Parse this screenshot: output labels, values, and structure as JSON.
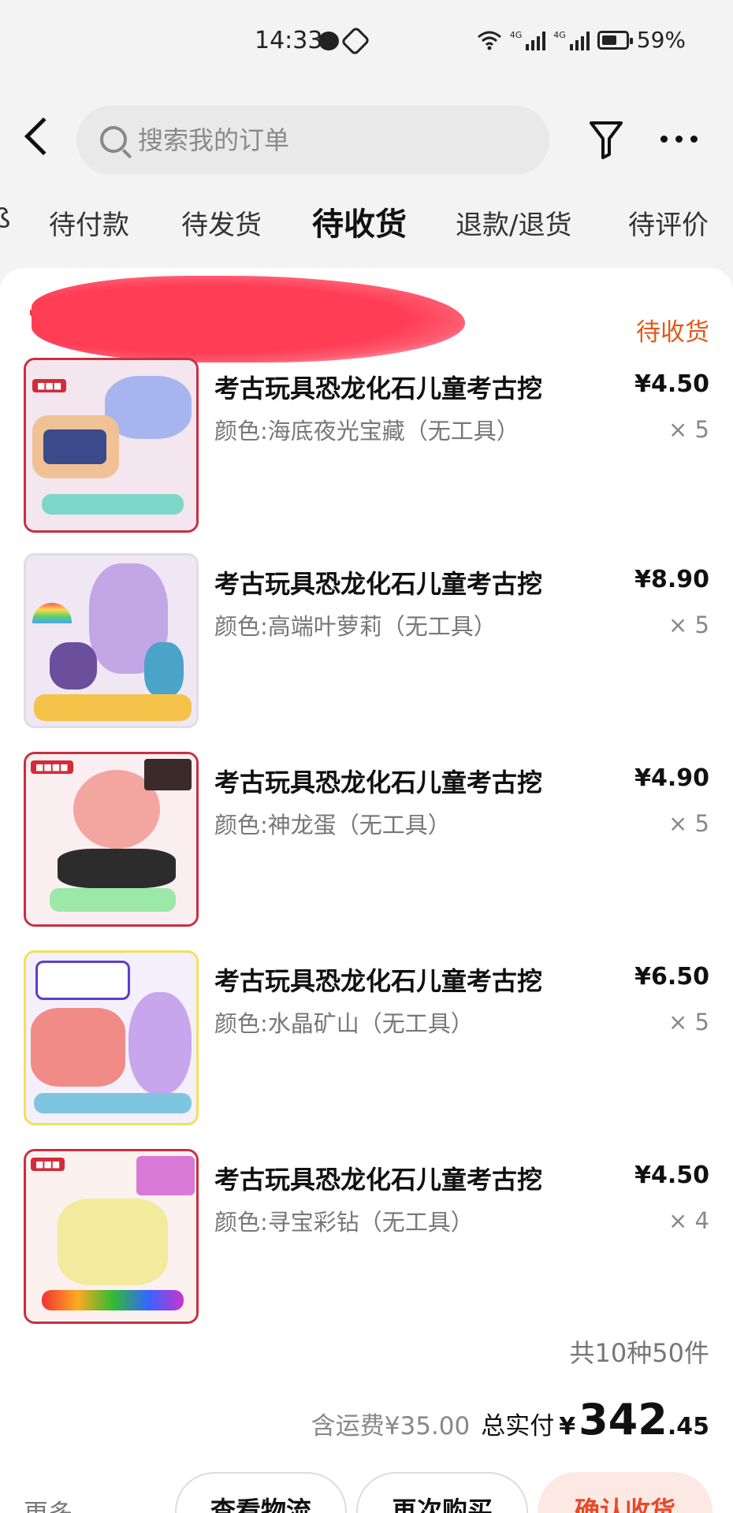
{
  "status_bar": {
    "time": "14:33",
    "battery": "59%",
    "signal_label_1": "4G",
    "signal_label_2": "4G"
  },
  "header": {
    "search_placeholder": "搜索我的订单"
  },
  "tabs": [
    {
      "label": "待付款"
    },
    {
      "label": "待发货"
    },
    {
      "label": "待收货",
      "active": true
    },
    {
      "label": "退款/退货"
    },
    {
      "label": "待评价"
    }
  ],
  "order": {
    "shop_name": "",
    "status": "待收货",
    "items": [
      {
        "title": "考古玩具恐龙化石儿童考古挖",
        "variant": "颜色:海底夜光宝藏（无工具）",
        "price": "¥4.50",
        "qty": "× 5"
      },
      {
        "title": "考古玩具恐龙化石儿童考古挖",
        "variant": "颜色:高端叶萝莉（无工具）",
        "price": "¥8.90",
        "qty": "× 5"
      },
      {
        "title": "考古玩具恐龙化石儿童考古挖",
        "variant": "颜色:神龙蛋（无工具）",
        "price": "¥4.90",
        "qty": "× 5"
      },
      {
        "title": "考古玩具恐龙化石儿童考古挖",
        "variant": "颜色:水晶矿山（无工具）",
        "price": "¥6.50",
        "qty": "× 5"
      },
      {
        "title": "考古玩具恐龙化石儿童考古挖",
        "variant": "颜色:寻宝彩钻（无工具）",
        "price": "¥4.50",
        "qty": "× 4"
      }
    ],
    "summary_count": "共10种50件",
    "shipping": "含运费¥35.00",
    "total_label": "总实付",
    "currency": "¥",
    "total_int": "342",
    "total_dec": ".45"
  },
  "actions": {
    "more": "更多",
    "view_logistics": "查看物流",
    "buy_again": "再次购买",
    "confirm_receipt": "确认收货"
  },
  "colors": {
    "accent": "#e8482a",
    "status_orange": "#e05a1a"
  }
}
